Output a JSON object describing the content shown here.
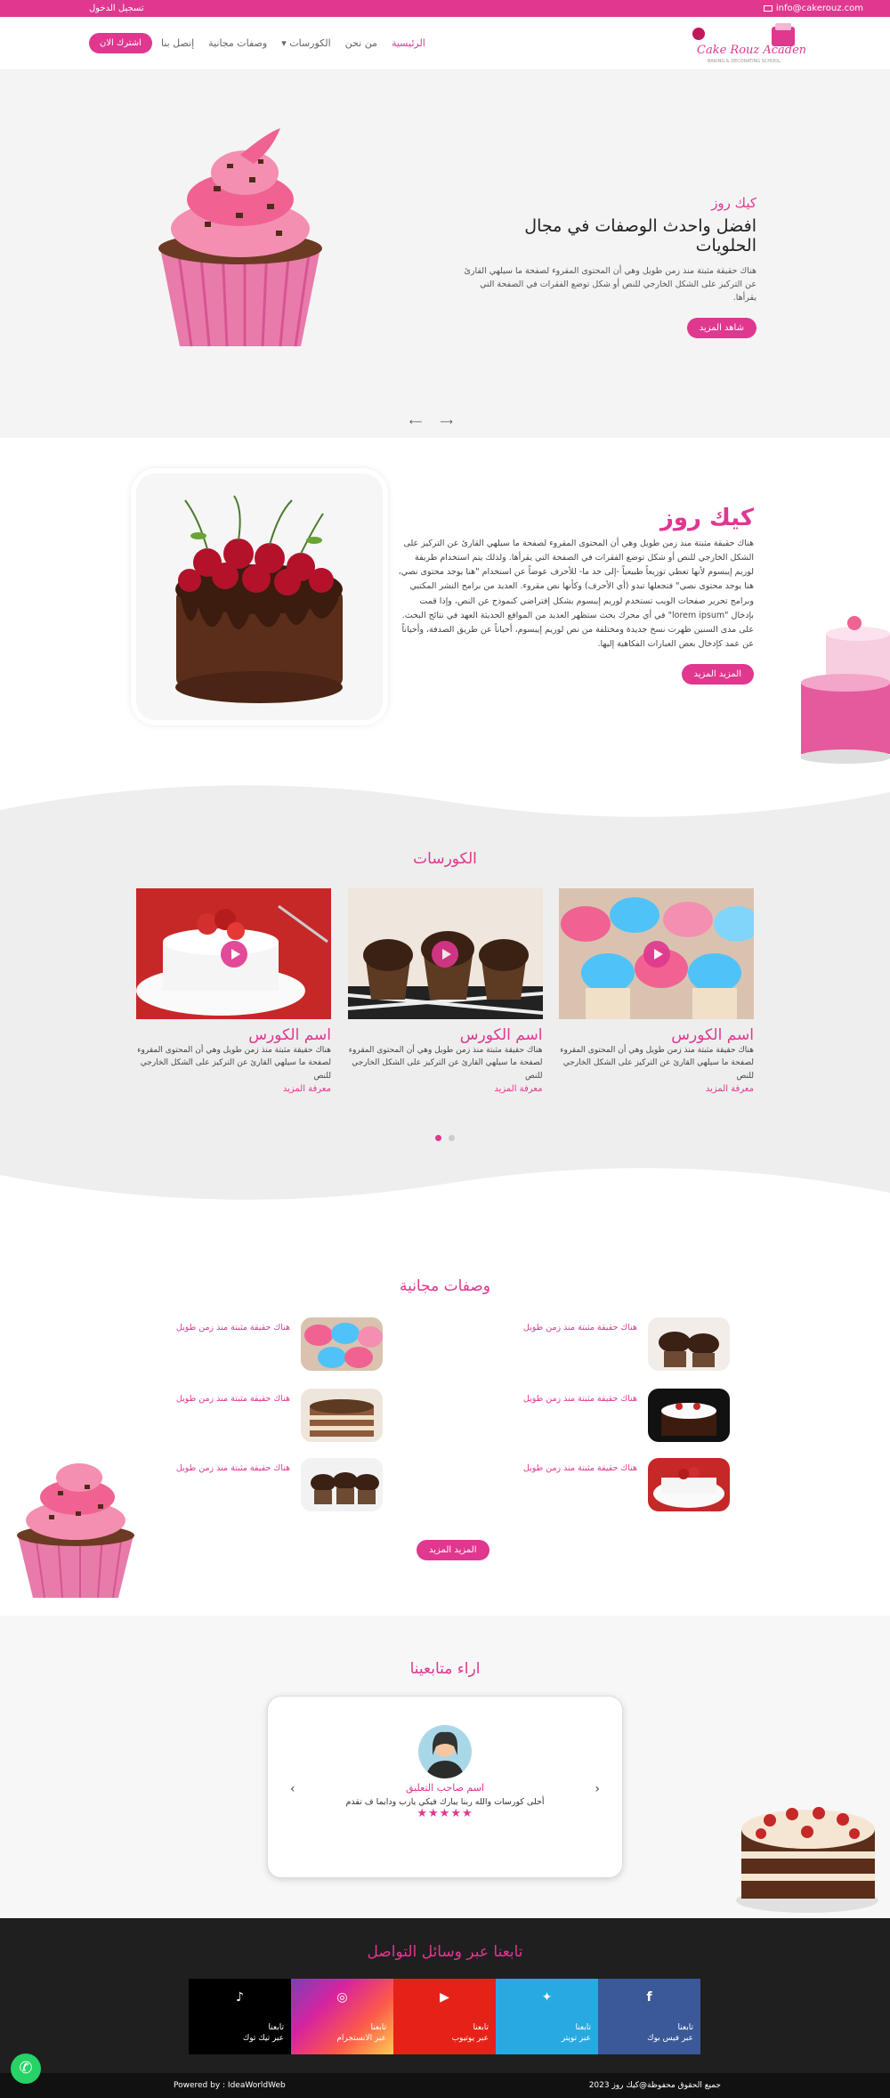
{
  "topbar": {
    "login": "تسجيل الدخول",
    "email": "info@cakerouz.com"
  },
  "header": {
    "join_label": "اشترك الان",
    "logo_text": "Cake Rouz Academy",
    "nav": [
      {
        "label": "الرئيسية"
      },
      {
        "label": "من نحن"
      },
      {
        "label": "الكورسات"
      },
      {
        "label": "وصفات مجانية"
      },
      {
        "label": "إتصل بنا"
      }
    ]
  },
  "hero": {
    "subtitle": "كيك روز",
    "title": "افضل واحدث الوصفات في مجال الحلويات",
    "paragraph": "هناك حقيقة مثبتة منذ زمن طويل وهي أن المحتوى المقروء لصفحة ما سيلهي القارئ عن التركيز على الشكل الخارجي للنص أو شكل توضع الفقرات في الصفحة التي يقرأها.",
    "button": "شاهد المزيد"
  },
  "about": {
    "title": "كيك روز",
    "paragraph": "هناك حقيقة مثبتة منذ زمن طويل وهي أن المحتوى المقروء لصفحة ما سيلهي القارئ عن التركيز على الشكل الخارجي للنص أو شكل توضع الفقرات في الصفحة التي يقرأها. ولذلك يتم استخدام طريقة لوريم إيبسوم لأنها تعطي توزيعاً طبيعياً -إلى حد ما- للأحرف عوضاً عن استخدام \"هنا يوجد محتوى نصي، هنا يوجد محتوى نصي\" فتجعلها تبدو (أي الأحرف) وكأنها نص مقروء. العديد من برامح النشر المكتبي وبرامح تحرير صفحات الويب تستخدم لوريم إيبسوم بشكل إفتراضي كنموذج عن النص، وإذا قمت بإدخال \"lorem ipsum\" في أي محرك بحث ستظهر العديد من المواقع الحديثة العهد في نتائج البحث. على مدى السنين ظهرت نسخ جديدة ومختلفة من نص لوريم إيبسوم، أحياناً عن طريق الصدفة، وأحياناً عن عمد كإدخال بعض العبارات الفكاهية إليها.",
    "button": "المزيد المزيد"
  },
  "courses": {
    "title": "الكورسات",
    "items": [
      {
        "title": "اسم الكورس",
        "text": "هناك حقيقة مثبتة منذ زمن طويل وهي أن المحتوى المقروء لصفحة ما سيلهي القارئ عن التركيز على الشكل الخارجي للنص",
        "more": "معرفة المزيد"
      },
      {
        "title": "اسم الكورس",
        "text": "هناك حقيقة مثبتة منذ زمن طويل وهي أن المحتوى المقروء لصفحة ما سيلهي القارئ عن التركيز على الشكل الخارجي للنص",
        "more": "معرفة المزيد"
      },
      {
        "title": "اسم الكورس",
        "text": "هناك حقيقة مثبتة منذ زمن طويل وهي أن المحتوى المقروء لصفحة ما سيلهي القارئ عن التركيز على الشكل الخارجي للنص",
        "more": "معرفة المزيد"
      }
    ]
  },
  "recipes": {
    "title": "وصفات مجانية",
    "items": [
      {
        "text": "هناك حقيقة مثبتة منذ زمن طويل"
      },
      {
        "text": "هناك حقيقة مثبتة منذ زمن طويل"
      },
      {
        "text": "هناك حقيقة مثبتة منذ زمن طويل"
      },
      {
        "text": "هناك حقيقة مثبتة منذ زمن طويل"
      },
      {
        "text": "هناك حقيقة مثبتة منذ زمن طويل"
      },
      {
        "text": "هناك حقيقة مثبتة منذ زمن طويل"
      }
    ],
    "button": "المزيد المزيد"
  },
  "testimonials": {
    "title": "اراء متابعينا",
    "name": "اسم صاحب التعليق",
    "text": "أحلى كورسات والله ربنا يبارك فيكي يارب ودايما ف تقدم",
    "stars": "★★★★★"
  },
  "footer": {
    "title": "تابعنا عبر وسائل التواصل",
    "social": [
      {
        "label": "تابعنا",
        "sub": "عبر تيك توك",
        "icon": "tiktok-icon",
        "glyph": "♪",
        "color": "#000000"
      },
      {
        "label": "تابعنا",
        "sub": "عبر الانستجرام",
        "icon": "instagram-icon",
        "glyph": "◎",
        "color": "#c13584"
      },
      {
        "label": "تابعنا",
        "sub": "عبر يوتيوب",
        "icon": "youtube-icon",
        "glyph": "▶",
        "color": "#e62117"
      },
      {
        "label": "تابعنا",
        "sub": "عبر تويتر",
        "icon": "twitter-icon",
        "glyph": "✦",
        "color": "#1da1f2"
      },
      {
        "label": "تابعنا",
        "sub": "عبر فيس بوك",
        "icon": "facebook-icon",
        "glyph": "f",
        "color": "#3b5998"
      }
    ],
    "powered": "Powered by : IdeaWorldWeb",
    "copyright": "جميع الحقوق محفوظة@كيك روز 2023"
  },
  "colors": {
    "accent": "#e0378f",
    "footer_bg": "#1f1f1f"
  }
}
